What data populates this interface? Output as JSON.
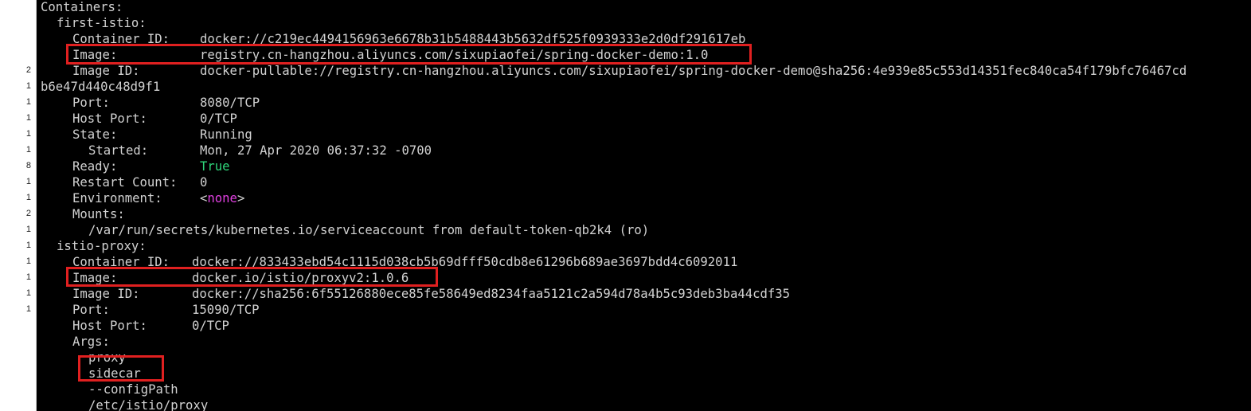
{
  "gutter": {
    "numbers": [
      "2",
      "1",
      "1",
      "1",
      "1",
      "1",
      "8",
      "1",
      "1",
      "2",
      "1",
      "1",
      "1",
      "1",
      "1",
      "1",
      "1"
    ]
  },
  "terminal": {
    "containers_heading": "Containers:",
    "first": {
      "name": "first-istio:",
      "container_id_key": "Container ID:",
      "container_id": "docker://c219ec4494156963e6678b31b5488443b5632df525f0939333e2d0df291617eb",
      "image_key": "Image:",
      "image": "registry.cn-hangzhou.aliyuncs.com/sixupiaofei/spring-docker-demo:1.0",
      "image_id_key": "Image ID:",
      "image_id": "docker-pullable://registry.cn-hangzhou.aliyuncs.com/sixupiaofei/spring-docker-demo@sha256:4e939e85c553d14351fec840ca54f179bfc76467cd",
      "image_id_cont": "b6e47d440c48d9f1",
      "port_key": "Port:",
      "port": "8080/TCP",
      "host_port_key": "Host Port:",
      "host_port": "0/TCP",
      "state_key": "State:",
      "state": "Running",
      "started_key": "Started:",
      "started": "Mon, 27 Apr 2020 06:37:32 -0700",
      "ready_key": "Ready:",
      "ready": "True",
      "restart_key": "Restart Count:",
      "restart": "0",
      "env_key": "Environment:",
      "env_lt": "<",
      "env_value": "none",
      "env_gt": ">",
      "mounts_key": "Mounts:",
      "mount": "/var/run/secrets/kubernetes.io/serviceaccount from default-token-qb2k4 (ro)"
    },
    "proxy": {
      "name": "istio-proxy:",
      "container_id_key": "Container ID:",
      "container_id": "docker://833433ebd54c1115d038cb5b69dfff50cdb8e61296b689ae3697bdd4c6092011",
      "image_key": "Image:",
      "image": "docker.io/istio/proxyv2:1.0.6",
      "image_id_key": "Image ID:",
      "image_id": "docker://sha256:6f55126880ece85fe58649ed8234faa5121c2a594d78a4b5c93deb3ba44cdf35",
      "port_key": "Port:",
      "port": "15090/TCP",
      "host_port_key": "Host Port:",
      "host_port": "0/TCP",
      "args_key": "Args:",
      "args": [
        "proxy",
        "sidecar",
        "--configPath",
        "/etc/istio/proxy"
      ]
    }
  },
  "colors": {
    "background": "#000000",
    "text": "#d2d2d2",
    "ready_green": "#2fd67a",
    "none_magenta": "#e040e0",
    "highlight_box": "#e02020"
  }
}
